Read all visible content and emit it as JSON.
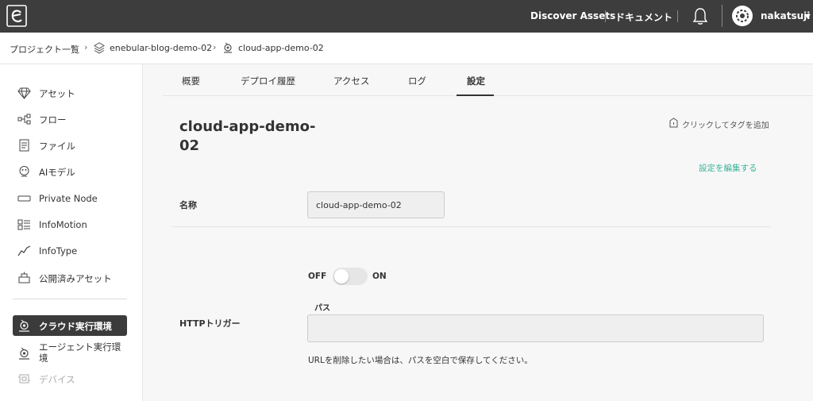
{
  "header": {
    "discover_assets": "Discover Assets",
    "documents": "ドキュメント",
    "user_name": "nakatsuji"
  },
  "breadcrumb": {
    "root": "プロジェクト一覧",
    "project": "enebular-blog-demo-02",
    "current": "cloud-app-demo-02"
  },
  "sidebar": {
    "items": [
      {
        "label": "アセット",
        "icon": "diamond-icon"
      },
      {
        "label": "フロー",
        "icon": "flow-icon"
      },
      {
        "label": "ファイル",
        "icon": "file-icon"
      },
      {
        "label": "AIモデル",
        "icon": "ai-model-icon"
      },
      {
        "label": "Private Node",
        "icon": "private-node-icon"
      },
      {
        "label": "InfoMotion",
        "icon": "infomotion-icon"
      },
      {
        "label": "InfoType",
        "icon": "infotype-icon"
      },
      {
        "label": "公開済みアセット",
        "icon": "published-assets-icon"
      },
      {
        "label": "クラウド実行環境",
        "icon": "cloud-runtime-icon"
      },
      {
        "label": "エージェント実行環境",
        "icon": "agent-runtime-icon"
      },
      {
        "label": "デバイス",
        "icon": "device-icon"
      }
    ]
  },
  "tabs": [
    "概要",
    "デプロイ履歴",
    "アクセス",
    "ログ",
    "設定"
  ],
  "active_tab": "設定",
  "main": {
    "title": "cloud-app-demo-02",
    "tag_add": "クリックしてタグを追加",
    "edit_link": "設定を編集する",
    "name_label": "名称",
    "name_value": "cloud-app-demo-02",
    "http_trigger_label": "HTTPトリガー",
    "toggle_off": "OFF",
    "toggle_on": "ON",
    "toggle_state": "off",
    "path_label": "パス",
    "path_value": "",
    "hint": "URLを削除したい場合は、パスを空白で保存してください。"
  },
  "colors": {
    "topbar": "#3d3d3d",
    "accent": "#3bb29b",
    "active_item": "#3b3b3b"
  }
}
